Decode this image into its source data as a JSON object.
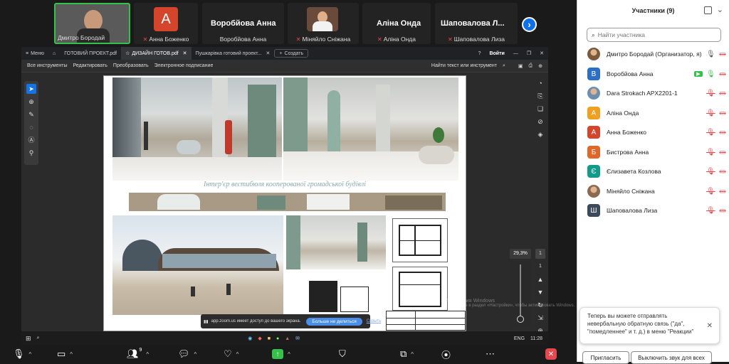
{
  "gallery": {
    "tiles": [
      {
        "name": "Дмитро Бородай",
        "muted": false
      },
      {
        "name": "Анна Боженко",
        "muted": true,
        "initial": "А",
        "color": "#d4452b"
      },
      {
        "name": "Воробйова Анна",
        "muted": false,
        "big": "Воробйова Анна"
      },
      {
        "name": "Міняйло Сніжана",
        "muted": true
      },
      {
        "name": "Аліна Онда",
        "muted": true,
        "big": "Аліна Онда"
      },
      {
        "name": "Шаповалова Лиза",
        "muted": true,
        "big": "Шаповалова Л..."
      }
    ]
  },
  "browser": {
    "menu": "Меню",
    "tabs": [
      "ГОТОВИЙ ПРОЕКТ.pdf",
      "ДИЗАЙН ГОТОВ.pdf",
      "Пушкарівка готовий проект..."
    ],
    "new_tab": "Создать",
    "login": "Войти"
  },
  "pdf_toolbar": {
    "items": [
      "Все инструменты",
      "Редактировать",
      "Преобразовать",
      "Электронное подписание"
    ],
    "search": "Найти текст или инструмент"
  },
  "pdf": {
    "title": "Інтер'єр вестибюля кооперованої громадської будівлі",
    "zoom": "29,3%",
    "page_current": "1",
    "page_total": "1"
  },
  "share_banner": {
    "text": "app.zoom.us имеет доступ до вашего экрана.",
    "stop": "Больше не делиться",
    "hide": "Скрыть"
  },
  "watermark": {
    "line1": "Активация Windows",
    "line2": "Перейдите в раздел «Настройки», чтобы активировать Windows."
  },
  "taskbar": {
    "lang": "ENG",
    "time": "11:28"
  },
  "zoom_bar": {
    "participants_count": "9"
  },
  "panel": {
    "title": "Участники (9)",
    "search_placeholder": "Найти участника",
    "participants": [
      {
        "name": "Дмитро Бородай (Организатор, я)",
        "initial": "",
        "color": "#7a5a3a",
        "photo": true,
        "mic": "on"
      },
      {
        "name": "Воробйова Анна",
        "initial": "В",
        "color": "#2d6fc4",
        "mic": "talking"
      },
      {
        "name": "Dara Strokach APX2201-1",
        "initial": "",
        "color": "#6a8fb0",
        "photo": true,
        "mic": "muted"
      },
      {
        "name": "Аліна Онда",
        "initial": "А",
        "color": "#f0a020",
        "mic": "muted"
      },
      {
        "name": "Анна Боженко",
        "initial": "А",
        "color": "#d4452b",
        "mic": "muted"
      },
      {
        "name": "Бистрова Анна",
        "initial": "Б",
        "color": "#e0662a",
        "mic": "muted"
      },
      {
        "name": "Єлизавета Козлова",
        "initial": "Є",
        "color": "#139b8a",
        "mic": "muted"
      },
      {
        "name": "Міняйло Сніжана",
        "initial": "",
        "color": "#8a6a50",
        "photo": true,
        "mic": "muted"
      },
      {
        "name": "Шаповалова Лиза",
        "initial": "Ш",
        "color": "#3a4a5a",
        "mic": "muted"
      }
    ],
    "notification": "Теперь вы можете отправлять невербальную обратную связь (\"да\", \"помедленнее\" и т. д.) в меню \"Реакции\"",
    "invite": "Пригласить",
    "mute_all": "Выключить звук для всех"
  }
}
